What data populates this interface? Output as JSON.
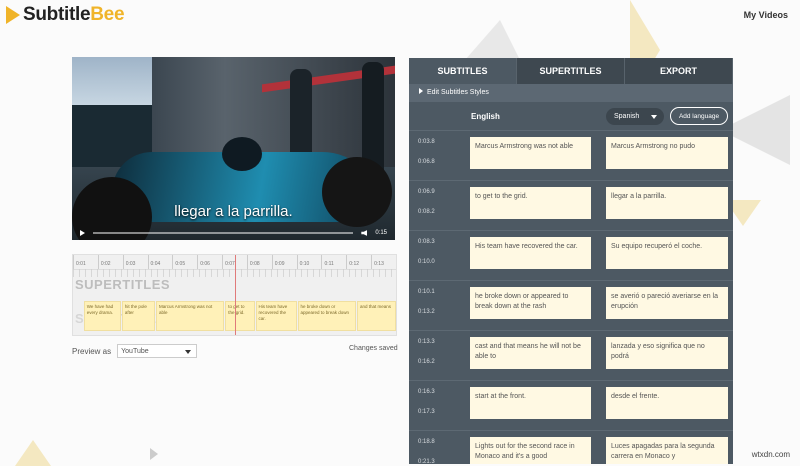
{
  "header": {
    "brand_a": "Subtitle",
    "brand_b": "Bee",
    "my_videos": "My Videos"
  },
  "video": {
    "caption": "llegar a la parrilla.",
    "time": "0:15"
  },
  "timeline": {
    "ticks": [
      "0:01",
      "0:02",
      "0:03",
      "0:04",
      "0:05",
      "0:06",
      "0:07",
      "0:08",
      "0:09",
      "0:10",
      "0:11",
      "0:12",
      "0:13"
    ],
    "label": "SUPERTITLES",
    "segments": [
      {
        "text": "We have had every drama."
      },
      {
        "text": "hit the pole after"
      },
      {
        "text": "Marcus Armstrong was not able"
      },
      {
        "text": "to get to the grid."
      },
      {
        "text": "His team have recovered the car."
      },
      {
        "text": "he broke down or appeared to break down"
      },
      {
        "text": "and that means"
      }
    ]
  },
  "preview": {
    "label": "Preview as",
    "value": "YouTube",
    "status": "Changes saved"
  },
  "editor": {
    "tabs": [
      {
        "label": "SUBTITLES"
      },
      {
        "label": "SUPERTITLES"
      },
      {
        "label": "EXPORT"
      }
    ],
    "styles_label": "Edit Subtitles Styles",
    "source_language": "English",
    "target_language": "Spanish",
    "add_language": "Add language",
    "rows": [
      {
        "start": "0:03.8",
        "end": "0:06.8",
        "en": "Marcus Armstrong was not able",
        "es": "Marcus Armstrong no pudo"
      },
      {
        "start": "0:06.9",
        "end": "0:08.2",
        "en": "to get to the grid.",
        "es": "llegar a la parrilla."
      },
      {
        "start": "0:08.3",
        "end": "0:10.0",
        "en": "His team have recovered the car.",
        "es": "Su equipo recuperó el coche."
      },
      {
        "start": "0:10.1",
        "end": "0:13.2",
        "en": "he broke down or appeared to break down at the rash",
        "es": "se averió o pareció averiarse en la erupción"
      },
      {
        "start": "0:13.3",
        "end": "0:16.2",
        "en": "cast and that means he will not be able to",
        "es": "lanzada y eso significa que no podrá"
      },
      {
        "start": "0:16.3",
        "end": "0:17.3",
        "en": "start at the front.",
        "es": "desde el frente."
      },
      {
        "start": "0:18.8",
        "end": "0:21.3",
        "en": "Lights out for the second race in Monaco and it's a good",
        "es": "Luces apagadas para la segunda carrera en Monaco y"
      }
    ]
  },
  "watermark": "wtxdn.com",
  "colors": {
    "accent": "#f0b429",
    "panel": "#4d5963",
    "cell": "#fff9e3"
  }
}
